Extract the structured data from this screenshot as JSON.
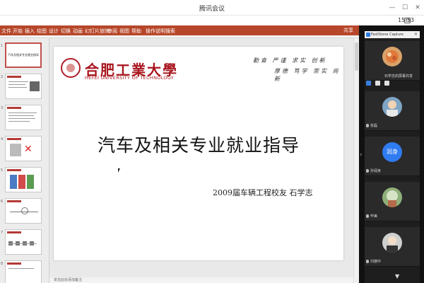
{
  "window": {
    "title": "腾讯会议",
    "time": "15:53",
    "signal": "16"
  },
  "ribbon": {
    "tabs": [
      "文件",
      "开始",
      "插入",
      "绘图",
      "设计",
      "切换",
      "动画",
      "幻灯片放映",
      "审阅",
      "视图",
      "帮助",
      "操作说明搜索"
    ],
    "share": "共享"
  },
  "thumbnails": {
    "numbers": [
      "1",
      "2",
      "3",
      "4",
      "5",
      "6",
      "7",
      "8"
    ],
    "first_title": "汽车及相关专业就业指导"
  },
  "slide": {
    "university_cn": "合肥工業大學",
    "university_en": "HEFEI UNIVERSITY OF TECHNOLOGY",
    "motto_line1": "勤奋 严谨 求实 创新",
    "motto_line2": "厚德 笃学 崇实 尚新",
    "main_title": "汽车及相关专业就业指导",
    "presenter": "2009届车辆工程校友 石学志"
  },
  "status": {
    "text": "单击此处添加备注"
  },
  "panel": {
    "header": "FastStone Capture",
    "participants": [
      {
        "name": "石学志的屏幕共享",
        "avatar": "photo-orange"
      },
      {
        "name": "张磊",
        "avatar": "photo-portrait"
      },
      {
        "name": "孙润身",
        "avatar": "initials",
        "initials": "润身"
      },
      {
        "name": "毕美",
        "avatar": "photo-plant"
      },
      {
        "name": "刘德中",
        "avatar": "photo-portrait-dark"
      }
    ]
  },
  "colors": {
    "ribbon": "#b7472a",
    "brand_red": "#a8151d",
    "avatar_blue": "#2f7bf0"
  }
}
